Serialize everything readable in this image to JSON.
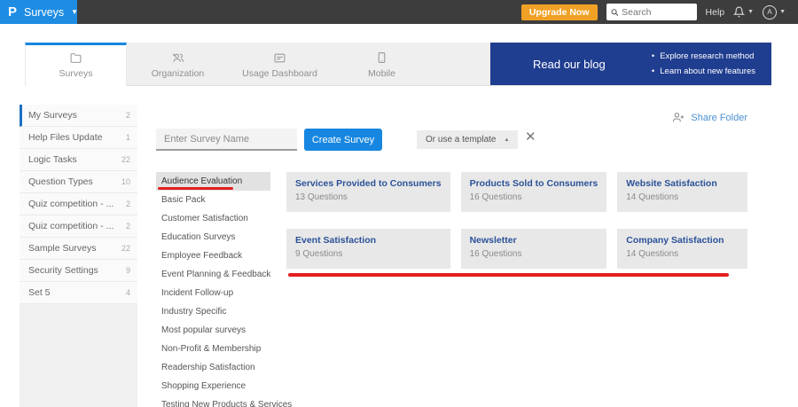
{
  "app": {
    "logo_letter": "P",
    "product_name": "Surveys"
  },
  "header": {
    "upgrade_button": "Upgrade Now",
    "search_placeholder": "Search",
    "help_label": "Help",
    "avatar_initial": "A"
  },
  "tabs": {
    "items": [
      {
        "label": "Surveys",
        "active": true
      },
      {
        "label": "Organization",
        "active": false
      },
      {
        "label": "Usage Dashboard",
        "active": false
      },
      {
        "label": "Mobile",
        "active": false
      }
    ]
  },
  "banner": {
    "title": "Read our blog",
    "bullets": [
      "Explore research method",
      "Learn about new features"
    ]
  },
  "sidebar": {
    "items": [
      {
        "label": "My Surveys",
        "count": "2",
        "active": true
      },
      {
        "label": "Help Files Update",
        "count": "1"
      },
      {
        "label": "Logic Tasks",
        "count": "22"
      },
      {
        "label": "Question Types",
        "count": "10"
      },
      {
        "label": "Quiz competition - ...",
        "count": "2"
      },
      {
        "label": "Quiz competition - ...",
        "count": "2"
      },
      {
        "label": "Sample Surveys",
        "count": "22"
      },
      {
        "label": "Security Settings",
        "count": "9"
      },
      {
        "label": "Set 5",
        "count": "4"
      }
    ]
  },
  "folder_actions": {
    "share_label": "Share Folder"
  },
  "create_survey": {
    "name_placeholder": "Enter Survey Name",
    "create_button": "Create Survey",
    "template_toggle": "Or use a template"
  },
  "template_panel": {
    "categories": [
      {
        "label": "Audience Evaluation",
        "selected": true
      },
      {
        "label": "Basic Pack"
      },
      {
        "label": "Customer Satisfaction"
      },
      {
        "label": "Education Surveys"
      },
      {
        "label": "Employee Feedback"
      },
      {
        "label": "Event Planning & Feedback"
      },
      {
        "label": "Incident Follow-up"
      },
      {
        "label": "Industry Specific"
      },
      {
        "label": "Most popular surveys"
      },
      {
        "label": "Non-Profit & Membership"
      },
      {
        "label": "Readership Satisfaction"
      },
      {
        "label": "Shopping Experience"
      },
      {
        "label": "Testing New Products & Services"
      }
    ],
    "cards": [
      {
        "title": "Services Provided to Consumers",
        "questions": "13 Questions"
      },
      {
        "title": "Products Sold to Consumers",
        "questions": "16 Questions"
      },
      {
        "title": "Website Satisfaction",
        "questions": "14 Questions"
      },
      {
        "title": "Event Satisfaction",
        "questions": "9 Questions"
      },
      {
        "title": "Newsletter",
        "questions": "16 Questions"
      },
      {
        "title": "Company Satisfaction",
        "questions": "14 Questions"
      }
    ]
  },
  "colors": {
    "header_bg": "#3d3d3d",
    "brand_blue": "#1e8ce3",
    "accent_blue": "#1786e0",
    "upgrade_orange": "#f0a125",
    "banner_navy": "#203e90",
    "card_title_blue": "#2b5298",
    "link_blue": "#4a90d2",
    "annotation_red": "#e41e1e"
  }
}
